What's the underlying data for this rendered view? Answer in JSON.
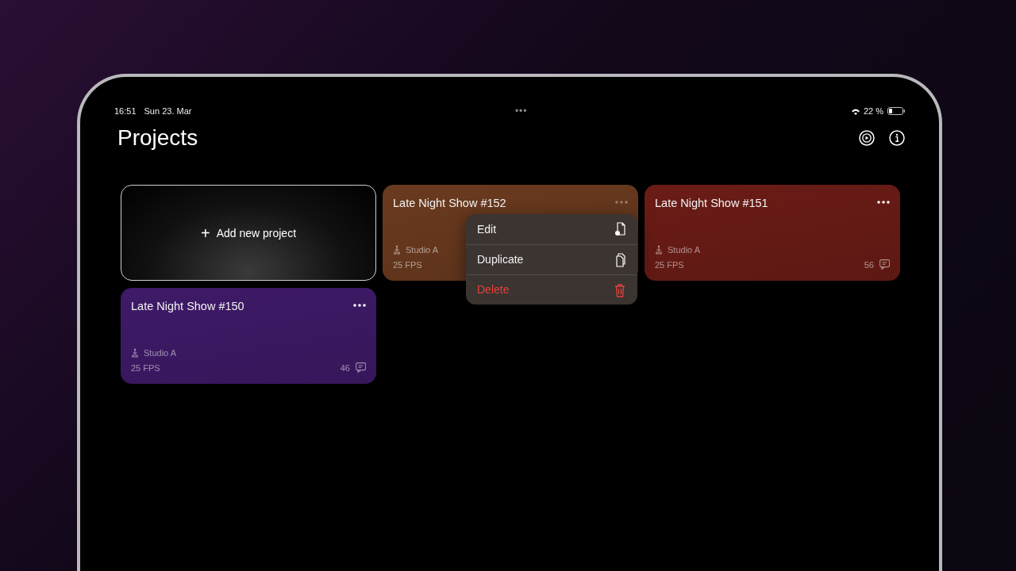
{
  "status_bar": {
    "time": "16:51",
    "date": "Sun 23. Mar",
    "multitask": "•••",
    "battery": "22 %"
  },
  "header": {
    "title": "Projects"
  },
  "cards": [
    {
      "kind": "add",
      "icon": "+",
      "label": "Add new project"
    },
    {
      "kind": "project",
      "title": "Late Night Show #152",
      "color": "#6a3a1f",
      "studio": "Studio A",
      "fps": "25 FPS",
      "menu_open": true,
      "context_menu": [
        {
          "label": "Edit",
          "kind": "normal"
        },
        {
          "label": "Duplicate",
          "kind": "normal"
        },
        {
          "label": "Delete",
          "kind": "destructive"
        }
      ]
    },
    {
      "kind": "project",
      "title": "Late Night Show #151",
      "color": "#6b1c16",
      "studio": "Studio A",
      "fps": "25 FPS",
      "comments": "56",
      "menu_open": false
    },
    {
      "kind": "project",
      "title": "Late Night Show #150",
      "color": "#3f1a68",
      "studio": "Studio A",
      "fps": "25 FPS",
      "comments": "46",
      "menu_open": false
    }
  ]
}
